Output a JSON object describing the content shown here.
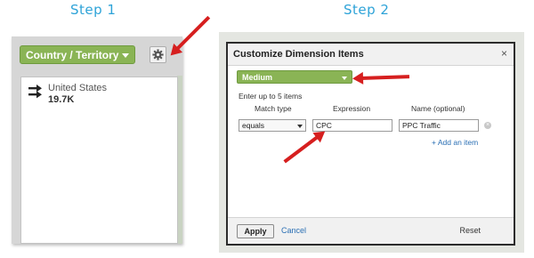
{
  "steps": {
    "step1": "Step 1",
    "step2": "Step 2"
  },
  "step1_panel": {
    "dimension_button": "Country / Territory",
    "gear_icon": "gear-icon",
    "row_icon": "arrows-icon",
    "row_label": "United States",
    "row_value": "19.7K"
  },
  "dialog": {
    "title": "Customize Dimension Items",
    "close": "×",
    "dimension_button": "Medium",
    "instruction": "Enter up to 5 items",
    "col_match": "Match type",
    "col_expression": "Expression",
    "col_name": "Name (optional)",
    "match_value": "equals",
    "expression_value": "CPC",
    "name_value": "PPC Traffic",
    "remove_icon": "remove-icon",
    "add_link": "+ Add an item",
    "apply": "Apply",
    "cancel": "Cancel",
    "reset": "Reset"
  },
  "colors": {
    "accent_green": "#8ab455",
    "step_blue": "#2ea3d8",
    "arrow_red": "#d61f1f"
  }
}
